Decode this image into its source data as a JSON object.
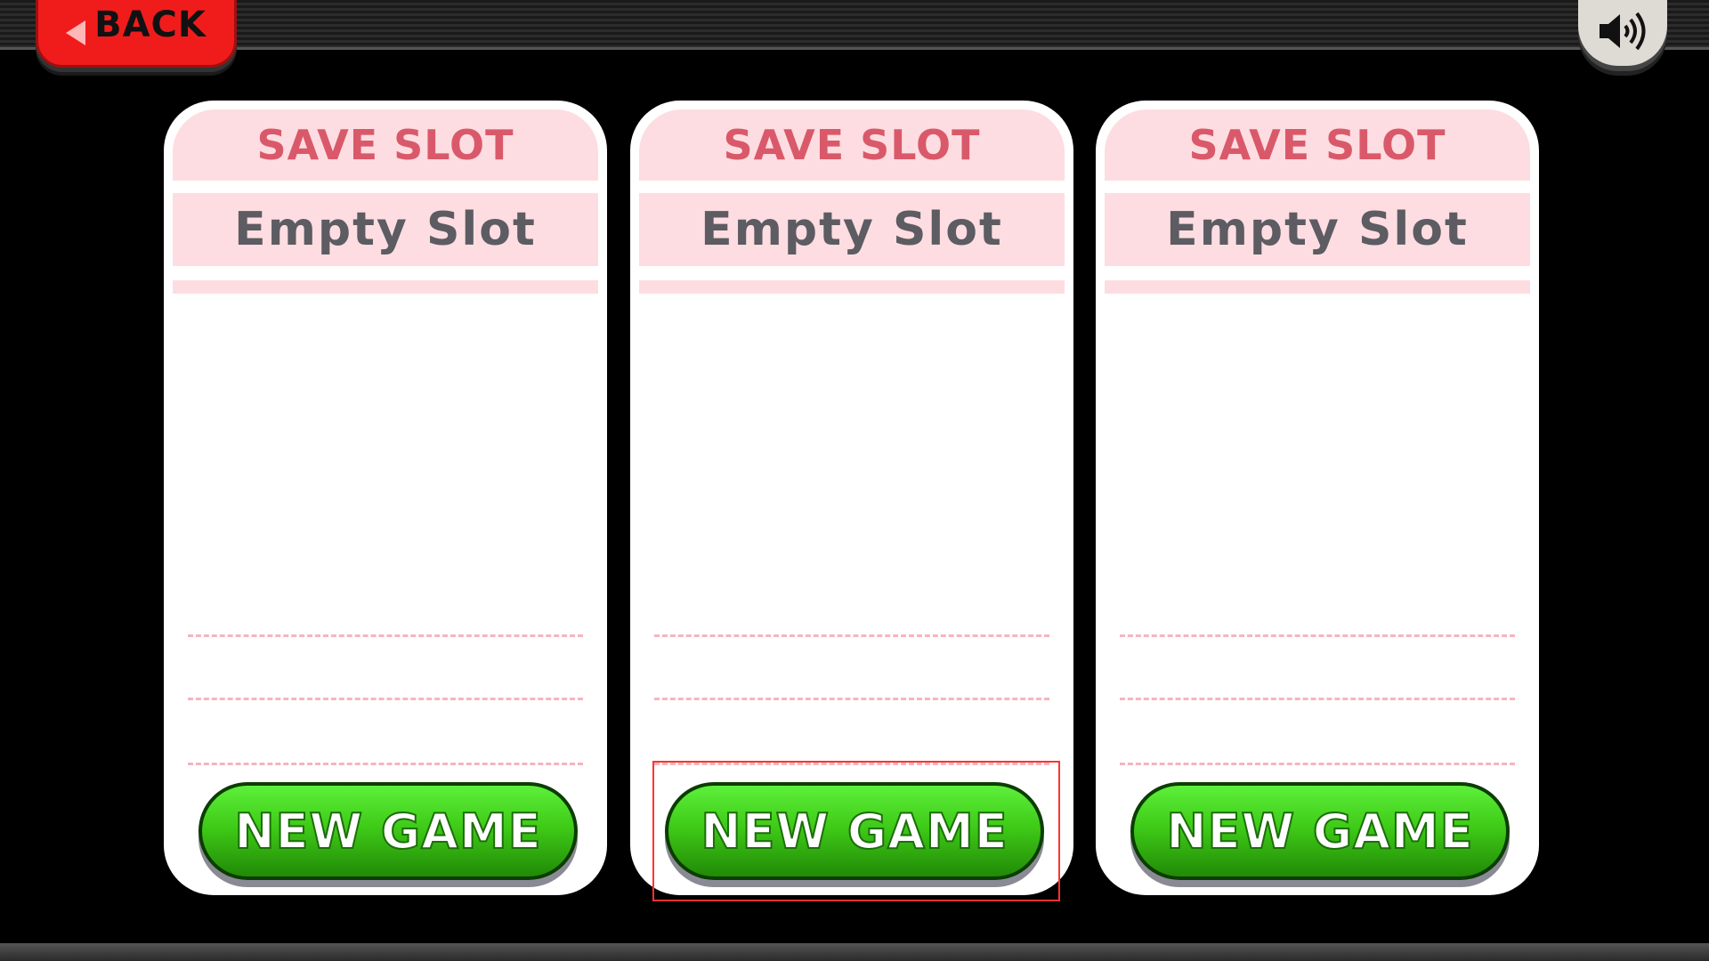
{
  "header": {
    "back_label": "BACK",
    "back_icon": "triangle-left-icon",
    "sound_icon": "speaker-icon"
  },
  "slots": [
    {
      "title": "SAVE SLOT",
      "status": "Empty Slot",
      "button": "NEW GAME"
    },
    {
      "title": "SAVE SLOT",
      "status": "Empty Slot",
      "button": "NEW GAME"
    },
    {
      "title": "SAVE SLOT",
      "status": "Empty Slot",
      "button": "NEW GAME"
    }
  ],
  "colors": {
    "back": "#f01c1c",
    "header_band": "#fddde1",
    "title": "#d9596a",
    "button": "#3fcb18",
    "highlight": "#ff3333"
  }
}
